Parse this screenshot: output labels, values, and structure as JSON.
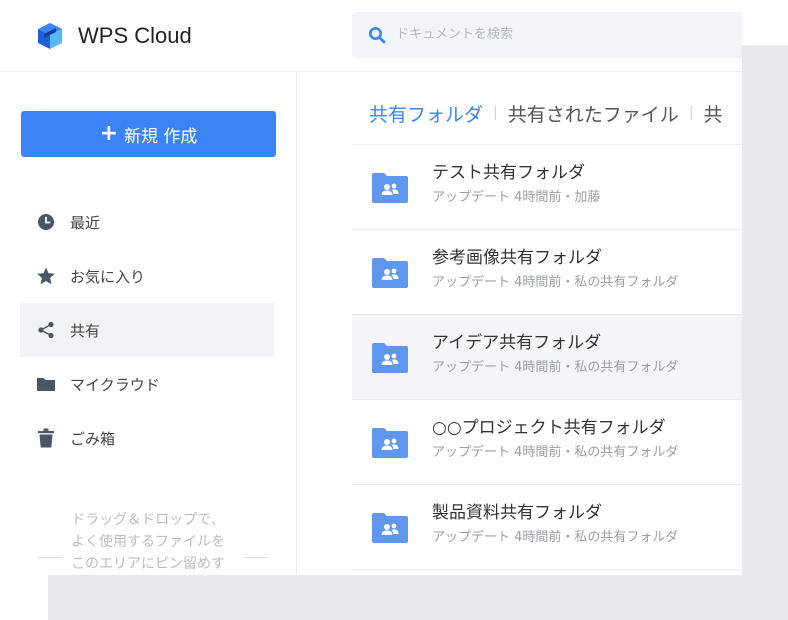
{
  "app": {
    "title": "WPS Cloud",
    "logo_icon": "wps-cloud-logo-icon",
    "accent_color": "#3c84f5"
  },
  "search": {
    "placeholder": "ドキュメントを検索",
    "icon": "search-icon"
  },
  "sidebar": {
    "new_button": {
      "plus": "+",
      "label": "新規 作成"
    },
    "items": [
      {
        "label": "最近",
        "icon": "clock-icon",
        "active": false
      },
      {
        "label": "お気に入り",
        "icon": "star-icon",
        "active": false
      },
      {
        "label": "共有",
        "icon": "share-icon",
        "active": true
      },
      {
        "label": "マイクラウド",
        "icon": "folder-icon",
        "active": false
      },
      {
        "label": "ごみ箱",
        "icon": "trash-icon",
        "active": false
      }
    ],
    "drop_hint": [
      "ドラッグ＆ドロップで、",
      "よく使用するファイルを",
      "このエリアにピン留めす"
    ]
  },
  "main": {
    "tabs": [
      {
        "label": "共有フォルダ",
        "active": true
      },
      {
        "label": "共有されたファイル",
        "active": false
      },
      {
        "label": "共",
        "active": false
      }
    ],
    "folders": [
      {
        "name": "テスト共有フォルダ",
        "meta": "アップデート 4時間前・加藤",
        "selected": false
      },
      {
        "name": "参考画像共有フォルダ",
        "meta": "アップデート 4時間前・私の共有フォルダ",
        "selected": false
      },
      {
        "name": "アイデア共有フォルダ",
        "meta": "アップデート 4時間前・私の共有フォルダ",
        "selected": true
      },
      {
        "name": "○○プロジェクト共有フォルダ",
        "meta": "アップデート 4時間前・私の共有フォルダ",
        "selected": false
      },
      {
        "name": "製品資料共有フォルダ",
        "meta": "アップデート 4時間前・私の共有フォルダ",
        "selected": false
      }
    ]
  }
}
